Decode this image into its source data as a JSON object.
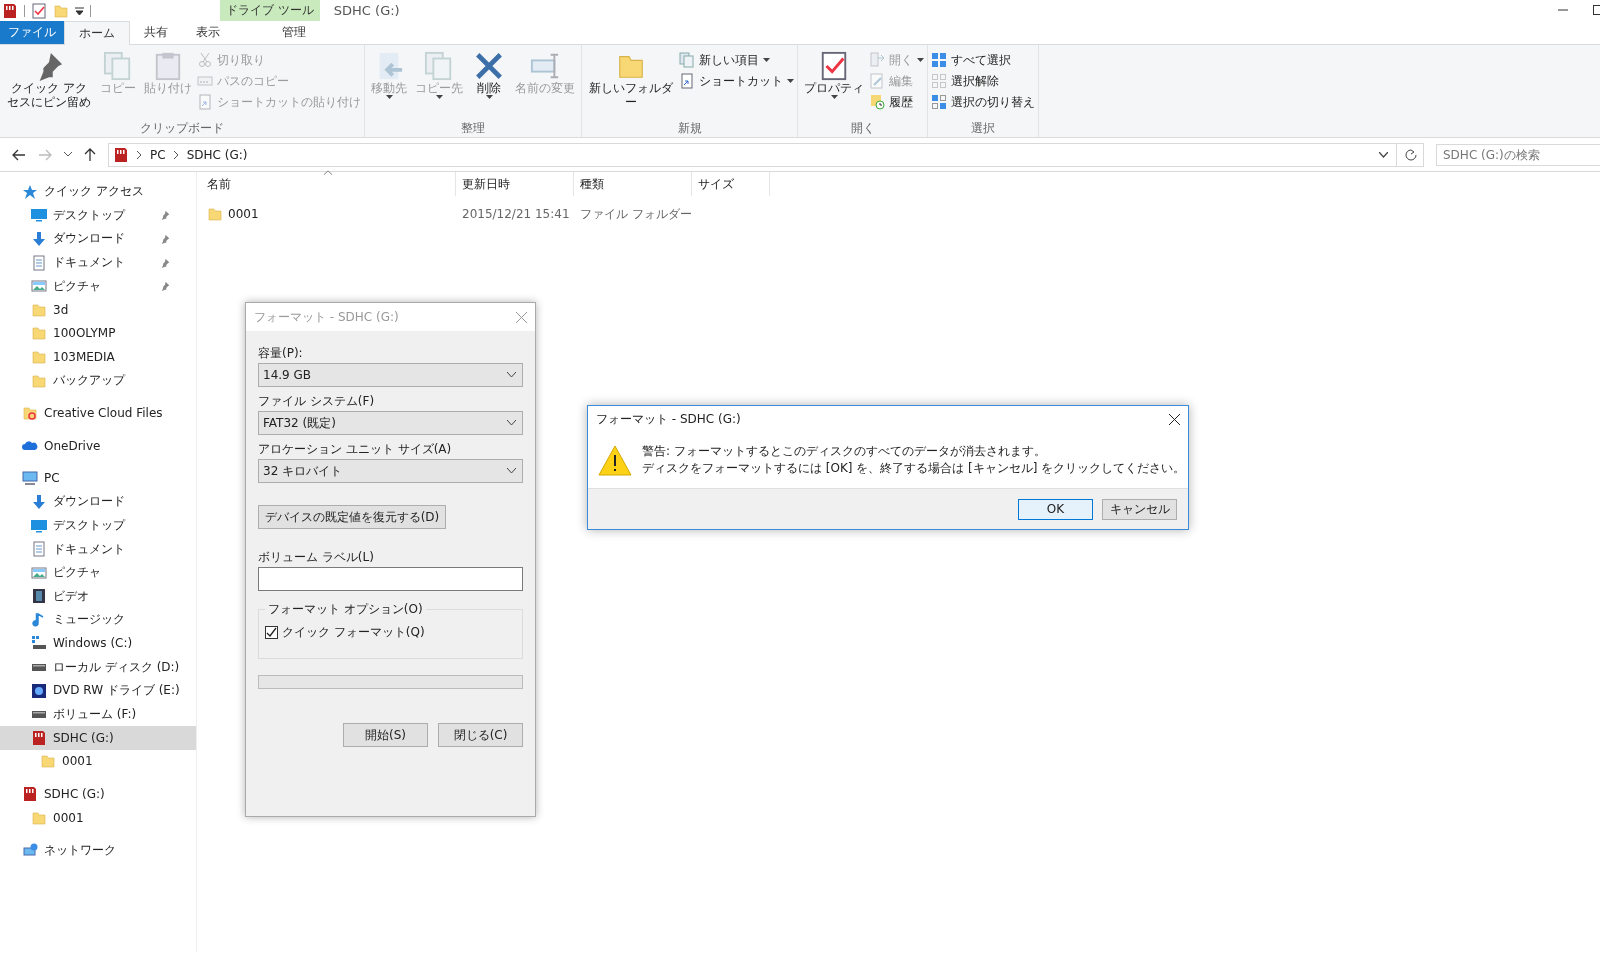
{
  "title_bar": {
    "context_group": "ドライブ ツール",
    "title": "SDHC (G:)"
  },
  "ribbon_tabs": [
    {
      "label": "ファイル",
      "kind": "file",
      "selected": false
    },
    {
      "label": "ホーム",
      "kind": "tab",
      "selected": true
    },
    {
      "label": "共有",
      "kind": "tab",
      "selected": false
    },
    {
      "label": "表示",
      "kind": "tab",
      "selected": false
    },
    {
      "label": "管理",
      "kind": "context",
      "selected": false
    }
  ],
  "ribbon_groups": [
    {
      "label": "クリップボード",
      "items": [
        {
          "kind": "large",
          "label": "クイック アクセスにピン留め",
          "disabled": false,
          "menu": false
        },
        {
          "kind": "large",
          "label": "コピー",
          "disabled": true,
          "menu": false
        },
        {
          "kind": "large",
          "label": "貼り付け",
          "disabled": true,
          "menu": false
        },
        {
          "kind": "small",
          "label": "切り取り",
          "disabled": true,
          "menu": false
        },
        {
          "kind": "small",
          "label": "パスのコピー",
          "disabled": true,
          "menu": false
        },
        {
          "kind": "small",
          "label": "ショートカットの貼り付け",
          "disabled": true,
          "menu": false
        }
      ]
    },
    {
      "label": "整理",
      "items": [
        {
          "kind": "large",
          "label": "移動先",
          "disabled": true,
          "menu": true
        },
        {
          "kind": "large",
          "label": "コピー先",
          "disabled": true,
          "menu": true
        },
        {
          "kind": "large",
          "label": "削除",
          "disabled": false,
          "menu": true
        },
        {
          "kind": "large",
          "label": "名前の変更",
          "disabled": true,
          "menu": false
        }
      ]
    },
    {
      "label": "新規",
      "items": [
        {
          "kind": "large",
          "label": "新しいフォルダー",
          "disabled": false,
          "menu": false
        },
        {
          "kind": "small",
          "label": "新しい項目",
          "disabled": false,
          "menu": true
        },
        {
          "kind": "small",
          "label": "ショートカット",
          "disabled": false,
          "menu": true
        }
      ]
    },
    {
      "label": "開く",
      "items": [
        {
          "kind": "large",
          "label": "プロパティ",
          "disabled": false,
          "menu": true
        },
        {
          "kind": "small",
          "label": "開く",
          "disabled": true,
          "menu": true
        },
        {
          "kind": "small",
          "label": "編集",
          "disabled": true,
          "menu": false
        },
        {
          "kind": "small",
          "label": "履歴",
          "disabled": false,
          "menu": false
        }
      ]
    },
    {
      "label": "選択",
      "items": [
        {
          "kind": "small",
          "label": "すべて選択",
          "disabled": false,
          "menu": false
        },
        {
          "kind": "small",
          "label": "選択解除",
          "disabled": false,
          "menu": false
        },
        {
          "kind": "small",
          "label": "選択の切り替え",
          "disabled": false,
          "menu": false
        }
      ]
    }
  ],
  "address": {
    "crumbs": [
      "PC",
      "SDHC (G:)"
    ]
  },
  "search": {
    "placeholder": "SDHC (G:)の検索"
  },
  "nav": [
    {
      "label": "クイック アクセス",
      "kind": "star",
      "selected": false,
      "children": [
        {
          "label": "デスクトップ",
          "kind": "desktop",
          "selected": false,
          "pinned": true
        },
        {
          "label": "ダウンロード",
          "kind": "download",
          "selected": false,
          "pinned": true
        },
        {
          "label": "ドキュメント",
          "kind": "document",
          "selected": false,
          "pinned": true
        },
        {
          "label": "ピクチャ",
          "kind": "picture",
          "selected": false,
          "pinned": true
        },
        {
          "label": "3d",
          "kind": "folder",
          "selected": false,
          "pinned": false
        },
        {
          "label": "100OLYMP",
          "kind": "folder",
          "selected": false,
          "pinned": false
        },
        {
          "label": "103MEDIA",
          "kind": "folder",
          "selected": false,
          "pinned": false
        },
        {
          "label": "バックアップ",
          "kind": "folder",
          "selected": false,
          "pinned": false
        }
      ]
    },
    {
      "label": "Creative Cloud Files",
      "kind": "ccfolder",
      "selected": false
    },
    {
      "label": "OneDrive",
      "kind": "cloud",
      "selected": false
    },
    {
      "label": "PC",
      "kind": "pc",
      "selected": false,
      "children": [
        {
          "label": "ダウンロード",
          "kind": "download",
          "selected": false
        },
        {
          "label": "デスクトップ",
          "kind": "desktop",
          "selected": false
        },
        {
          "label": "ドキュメント",
          "kind": "document",
          "selected": false
        },
        {
          "label": "ピクチャ",
          "kind": "picture",
          "selected": false
        },
        {
          "label": "ビデオ",
          "kind": "film",
          "selected": false
        },
        {
          "label": "ミュージック",
          "kind": "music",
          "selected": false
        },
        {
          "label": "Windows (C:)",
          "kind": "windrive",
          "selected": false
        },
        {
          "label": "ローカル ディスク (D:)",
          "kind": "drive",
          "selected": false
        },
        {
          "label": "DVD RW ドライブ (E:)",
          "kind": "dvd",
          "selected": false
        },
        {
          "label": "ボリューム (F:)",
          "kind": "drive",
          "selected": false
        },
        {
          "label": "SDHC (G:)",
          "kind": "sd",
          "selected": true,
          "children": [
            {
              "label": "0001",
              "kind": "folder",
              "selected": false
            }
          ]
        }
      ]
    },
    {
      "label": "SDHC (G:)",
      "kind": "sd",
      "selected": false,
      "children": [
        {
          "label": "0001",
          "kind": "folder",
          "selected": false
        }
      ]
    },
    {
      "label": "ネットワーク",
      "kind": "network",
      "selected": false
    }
  ],
  "columns": [
    {
      "label": "名前",
      "sorted": true
    },
    {
      "label": "更新日時",
      "sorted": false
    },
    {
      "label": "種類",
      "sorted": false
    },
    {
      "label": "サイズ",
      "sorted": false
    }
  ],
  "files": [
    {
      "name": "0001",
      "modified": "2015/12/21 15:41",
      "type": "ファイル フォルダー"
    }
  ],
  "format_dialog": {
    "title": "フォーマット - SDHC (G:)",
    "selects": [
      {
        "label": "容量(P):",
        "value": "14.9 GB"
      },
      {
        "label": "ファイル システム(F)",
        "value": "FAT32 (既定)"
      },
      {
        "label": "アロケーション ユニット サイズ(A)",
        "value": "32 キロバイト"
      }
    ],
    "restore_button": "デバイスの既定値を復元する(D)",
    "volume_label": "ボリューム ラベル(L)",
    "options_label": "フォーマット オプション(O)",
    "quick_format": {
      "label": "クイック フォーマット(Q)",
      "checked": true
    },
    "progress": {
      "level": 0
    },
    "buttons": [
      "開始(S)",
      "閉じる(C)"
    ]
  },
  "confirm_dialog": {
    "title": "フォーマット - SDHC (G:)",
    "lines": [
      "警告: フォーマットするとこのディスクのすべてのデータが消去されます。",
      "ディスクをフォーマットするには [OK] を、終了する場合は [キャンセル] をクリックしてください。"
    ],
    "buttons": [
      {
        "label": "OK",
        "default": true
      },
      {
        "label": "キャンセル",
        "default": false
      }
    ]
  }
}
